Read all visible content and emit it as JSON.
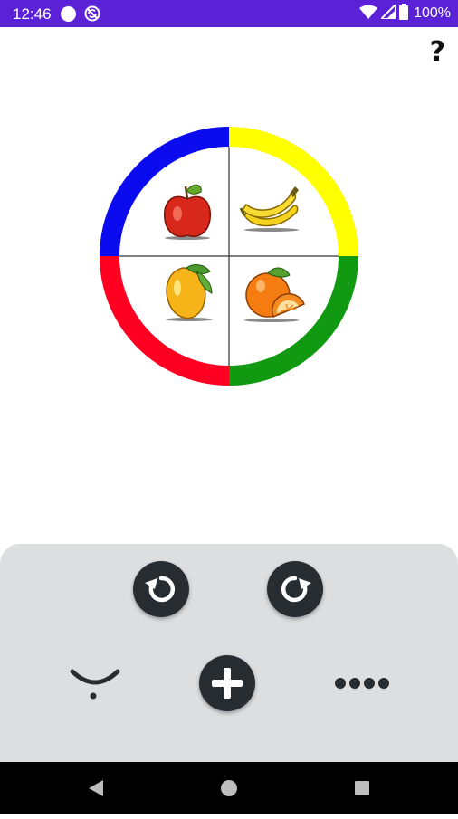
{
  "status_bar": {
    "time": "12:46",
    "battery": "100%",
    "icons": [
      "circle-notification-icon",
      "no-sync-icon",
      "wifi-icon",
      "signal-icon",
      "battery-icon"
    ],
    "background": "#5b21d6"
  },
  "help": {
    "label": "?"
  },
  "wheel": {
    "quadrants": [
      {
        "position": "top-left",
        "ring_color": "#0b0bf0",
        "fruit": "apple-icon"
      },
      {
        "position": "top-right",
        "ring_color": "#ffff00",
        "fruit": "banana-icon"
      },
      {
        "position": "bottom-left",
        "ring_color": "#ff0022",
        "fruit": "mango-icon"
      },
      {
        "position": "bottom-right",
        "ring_color": "#119911",
        "fruit": "orange-icon"
      }
    ]
  },
  "controls": {
    "rotate_left_icon": "rotate-counterclockwise-icon",
    "rotate_right_icon": "rotate-clockwise-icon",
    "add_icon": "plus-icon",
    "smile_icon": "smile-curve-icon",
    "more_icon": "more-dots-icon",
    "panel_color": "#dcdee0",
    "button_color": "#262c30"
  },
  "nav_bar": {
    "icons": [
      "back-icon",
      "home-icon",
      "recents-icon"
    ]
  }
}
